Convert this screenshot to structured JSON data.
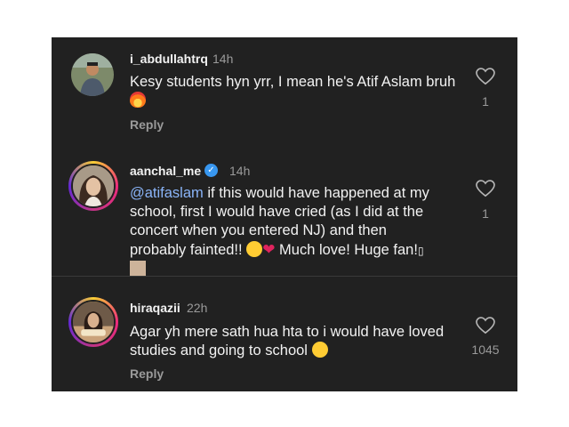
{
  "comments": [
    {
      "username": "i_abdullahtrq",
      "time": "14h",
      "text": "Kesy students hyn yrr, I mean he's Atif Aslam bruh",
      "reply": "Reply",
      "likes": "1",
      "avatar_icon": "avatar-man"
    },
    {
      "username": "aanchal_me",
      "time": "14h",
      "mention": "@atifaslam",
      "text_line1": " if this would have happened at my",
      "text_line2": "school, first I would have cried (as I did at the",
      "text_line3": "concert when you entered NJ) and then",
      "text_line4": "probably fainted!!",
      "text_line4b": " Much love! Huge fan!",
      "likes": "1",
      "verified": true,
      "avatar_icon": "avatar-woman"
    },
    {
      "username": "hiraqazii",
      "time": "22h",
      "text_line1": "Agar yh mere sath hua hta to i would have loved",
      "text_line2": "studies and going to school",
      "reply": "Reply",
      "likes": "1045",
      "avatar_icon": "avatar-woman-2"
    }
  ],
  "colors": {
    "background": "#212121",
    "text": "#f2f2f2",
    "muted": "#9a9a9a",
    "mention": "#8ab4f8",
    "verified": "#3897f0"
  }
}
